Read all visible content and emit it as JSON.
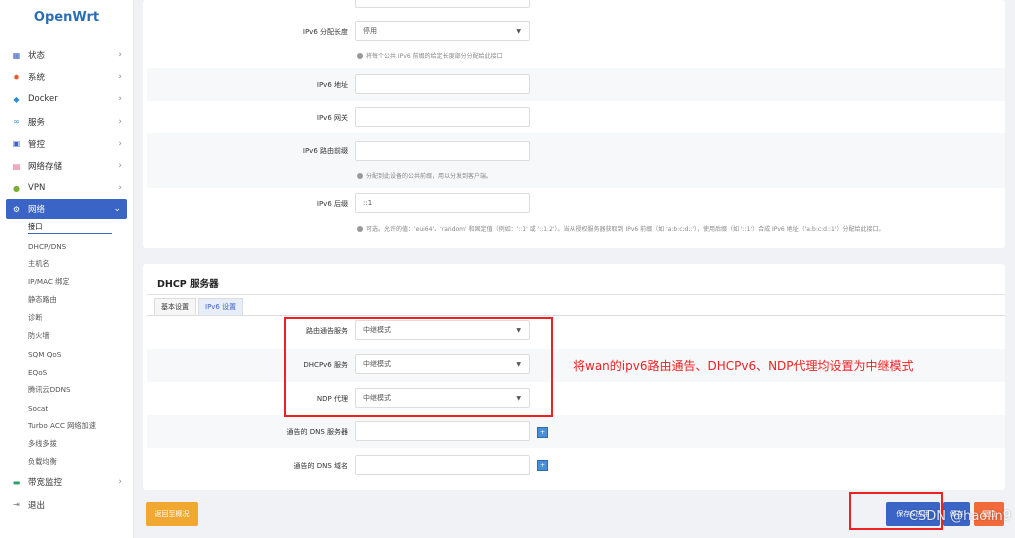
{
  "app": {
    "logo": "OpenWrt"
  },
  "sidebar": {
    "items": [
      {
        "label": "状态",
        "icon": "dashboard-icon"
      },
      {
        "label": "系统",
        "icon": "gear-icon"
      },
      {
        "label": "Docker",
        "icon": "docker-icon"
      },
      {
        "label": "服务",
        "icon": "services-icon"
      },
      {
        "label": "管控",
        "icon": "control-icon"
      },
      {
        "label": "网络存储",
        "icon": "storage-icon"
      },
      {
        "label": "VPN",
        "icon": "vpn-icon"
      },
      {
        "label": "网络",
        "icon": "network-icon"
      }
    ],
    "network_sub": [
      "接口",
      "DHCP/DNS",
      "主机名",
      "IP/MAC 绑定",
      "静态路由",
      "诊断",
      "防火墙",
      "SQM QoS",
      "EQoS",
      "腾讯云DDNS",
      "Socat",
      "Turbo ACC 网络加速",
      "多线多拨",
      "负载均衡"
    ],
    "bottom_items": [
      {
        "label": "带宽监控",
        "icon": "bandwidth-icon"
      },
      {
        "label": "退出",
        "icon": "logout-icon"
      }
    ]
  },
  "ipv6": {
    "assign_length_label": "IPv6 分配长度",
    "assign_length_value": "停用",
    "assign_length_hint": "将每个公共 IPv6 前缀的给定长度部分分配给此接口",
    "address_label": "IPv6 地址",
    "gateway_label": "IPv6 网关",
    "prefix_label": "IPv6 路由前缀",
    "prefix_hint": "分配到此设备的公共前缀，用以分发到客户端。",
    "suffix_label": "IPv6 后缀",
    "suffix_value": "::1",
    "suffix_hint": "可选。允许的值：'eui64'、'random' 和固定值（例如：'::1' 或 '::1:2'）。当从授权服务器获取到 IPv6 前缀（如 'a:b:c:d::'），使用后缀（如 '::1'）合成 IPv6 地址（'a:b:c:d::1'）分配给此接口。"
  },
  "dhcp": {
    "title": "DHCP 服务器",
    "tabs": [
      "基本设置",
      "IPv6 设置"
    ],
    "ra_label": "路由通告服务",
    "ra_value": "中继模式",
    "dhcpv6_label": "DHCPv6 服务",
    "dhcpv6_value": "中继模式",
    "ndp_label": "NDP 代理",
    "ndp_value": "中继模式",
    "dns_server_label": "通告的 DNS 服务器",
    "dns_domain_label": "通告的 DNS 域名"
  },
  "annotation": "将wan的ipv6路由通告、DHCPv6、NDP代理均设置为中继模式",
  "buttons": {
    "back": "返回至概况",
    "save_apply": "保存&应用",
    "save": "保存",
    "reset": "复位"
  },
  "watermark": "CSDN @haolin9",
  "colors": {
    "accent": "#3a64c6",
    "annotation": "#e22222",
    "back_button": "#f0a830",
    "reset_button": "#f06a3a"
  }
}
